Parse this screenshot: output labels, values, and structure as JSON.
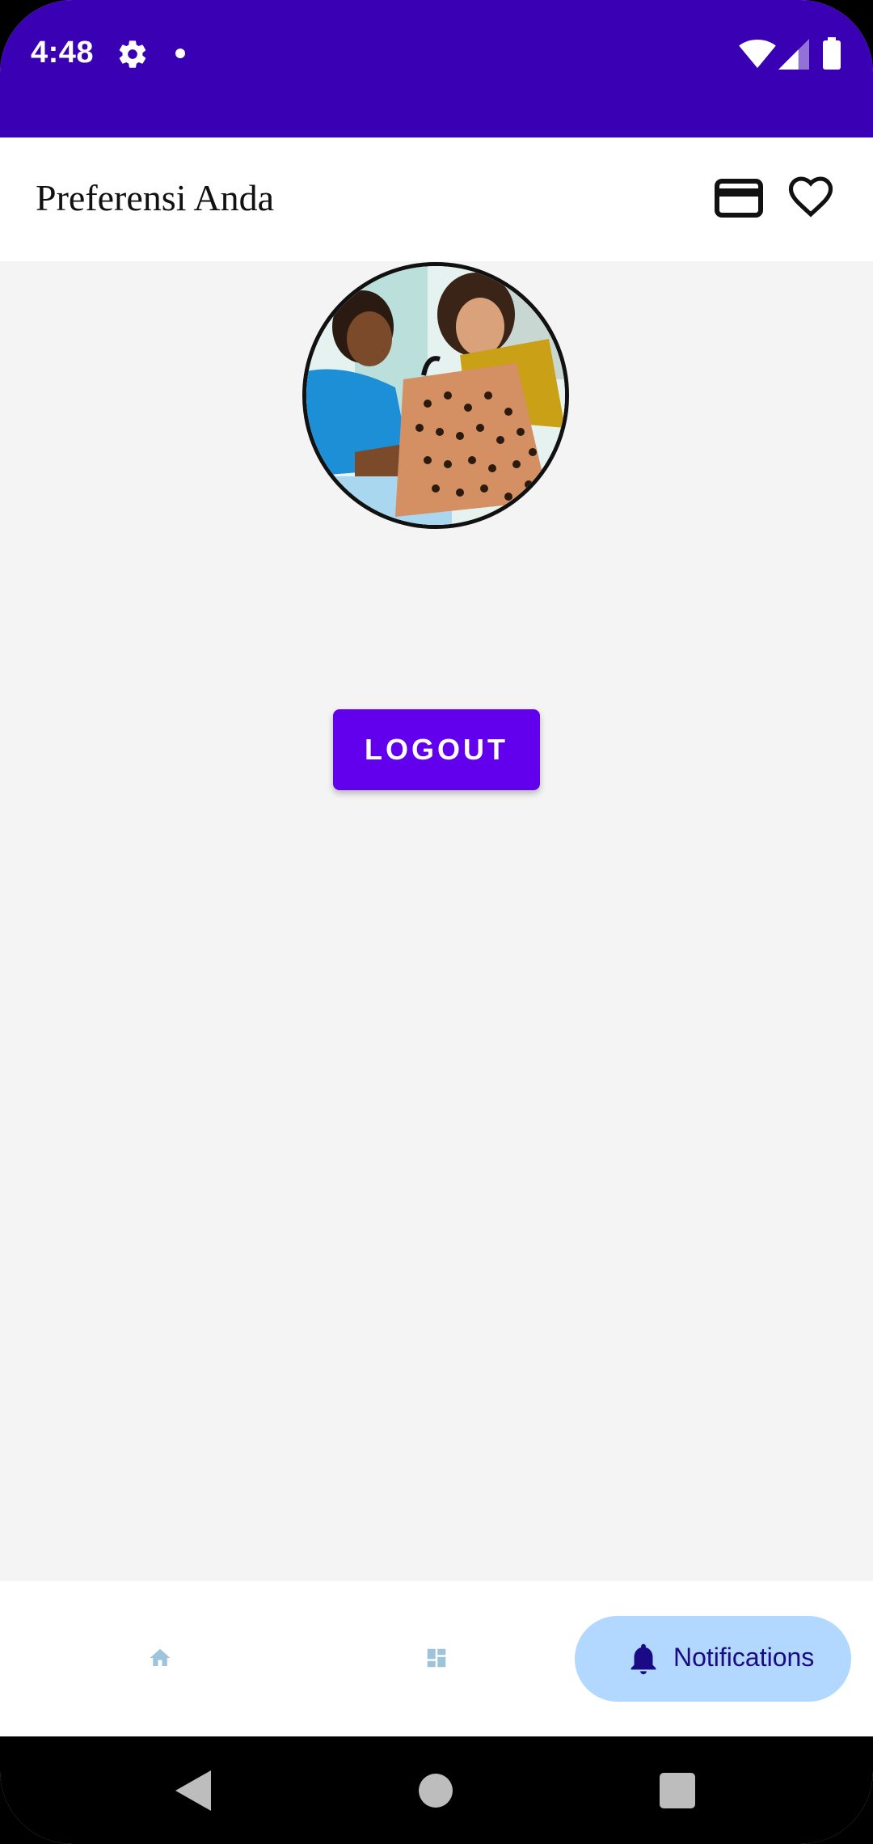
{
  "status_bar": {
    "time": "4:48",
    "icons": [
      "gear-icon",
      "notification-dot",
      "wifi-icon",
      "signal-icon",
      "battery-icon"
    ],
    "background_color": "#3a00b3"
  },
  "app_bar": {
    "title": "Preferensi Anda",
    "actions": [
      "credit-card-icon",
      "heart-icon"
    ]
  },
  "profile": {
    "avatar": "profile-photo"
  },
  "logout": {
    "label": "LOGOUT",
    "color": "#6200ee"
  },
  "bottom_nav": {
    "items": [
      {
        "icon": "home-icon",
        "label": "",
        "active": false
      },
      {
        "icon": "dashboard-icon",
        "label": "",
        "active": false
      },
      {
        "icon": "bell-icon",
        "label": "Notifications",
        "active": true
      }
    ],
    "active_pill_color": "#b2d8ff",
    "inactive_icon_color": "#9ec4dc"
  },
  "system_nav": {
    "buttons": [
      "back-icon",
      "home-circle-icon",
      "recents-square-icon"
    ]
  }
}
